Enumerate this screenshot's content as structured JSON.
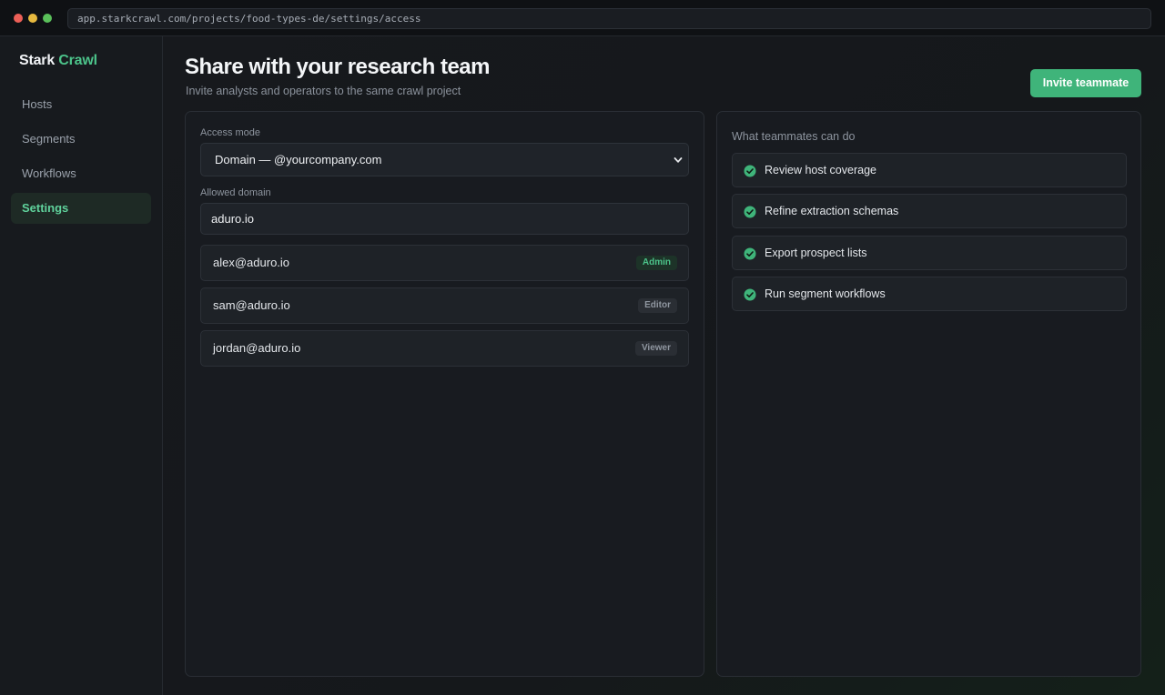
{
  "browser": {
    "url": "app.starkcrawl.com/projects/food-types-de/settings/access"
  },
  "brand": {
    "name_primary": "Stark",
    "name_accent": "Crawl",
    "accent_color": "#4cc38a"
  },
  "sidebar": {
    "items": [
      {
        "label": "Hosts",
        "active": false
      },
      {
        "label": "Segments",
        "active": false
      },
      {
        "label": "Workflows",
        "active": false
      },
      {
        "label": "Settings",
        "active": true
      }
    ]
  },
  "header": {
    "title": "Share with your research team",
    "subtitle": "Invite analysts and operators to the same crawl project",
    "invite_button": "Invite teammate"
  },
  "access": {
    "mode_label": "Access mode",
    "mode_value": "Domain — @yourcompany.com",
    "domain_label": "Allowed domain",
    "domain_value": "aduro.io"
  },
  "members": [
    {
      "email": "alex@aduro.io",
      "role": "Admin"
    },
    {
      "email": "sam@aduro.io",
      "role": "Editor"
    },
    {
      "email": "jordan@aduro.io",
      "role": "Viewer"
    }
  ],
  "permissions": {
    "heading": "What teammates can do",
    "items": [
      {
        "label": "Review host coverage",
        "icon": "check-circle-icon"
      },
      {
        "label": "Refine extraction schemas",
        "icon": "check-circle-icon"
      },
      {
        "label": "Export prospect lists",
        "icon": "check-circle-icon"
      },
      {
        "label": "Run segment workflows",
        "icon": "check-circle-icon"
      }
    ]
  }
}
